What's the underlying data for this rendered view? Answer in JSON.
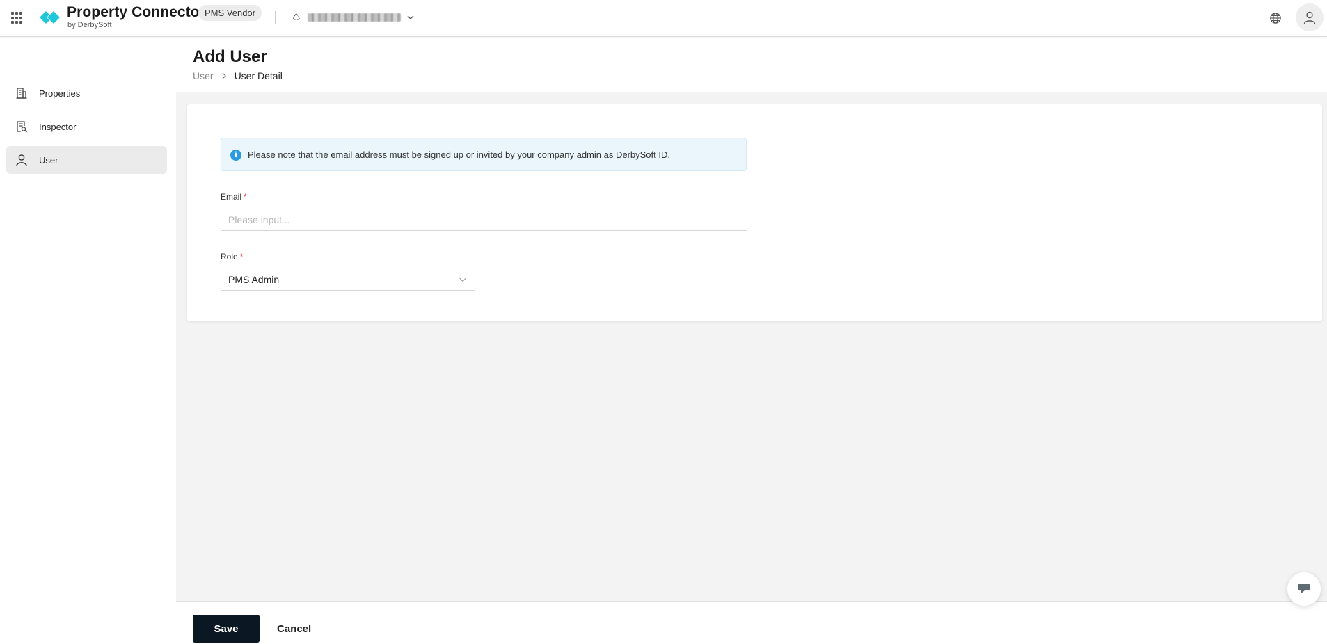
{
  "header": {
    "brand_title": "Property Connector",
    "brand_subtitle": "by DerbySoft",
    "vendor_badge": "PMS Vendor",
    "account_name": "",
    "brand_color": "#1ec8d8"
  },
  "sidebar": {
    "items": [
      {
        "label": "Properties",
        "icon": "building-icon",
        "active": false
      },
      {
        "label": "Inspector",
        "icon": "document-search-icon",
        "active": false
      },
      {
        "label": "User",
        "icon": "user-icon",
        "active": true
      }
    ]
  },
  "page": {
    "title": "Add User",
    "breadcrumb": [
      "User",
      "User Detail"
    ]
  },
  "form": {
    "notice": "Please note that the email address must be signed up or invited by your company admin as DerbySoft ID.",
    "email_label": "Email",
    "email_placeholder": "Please input...",
    "email_value": "",
    "role_label": "Role",
    "role_value": "PMS Admin",
    "required_mark": "*"
  },
  "footer": {
    "save_label": "Save",
    "cancel_label": "Cancel"
  },
  "colors": {
    "primary_button": "#0b1722",
    "info": "#2a9be0",
    "required": "#e0283c"
  }
}
